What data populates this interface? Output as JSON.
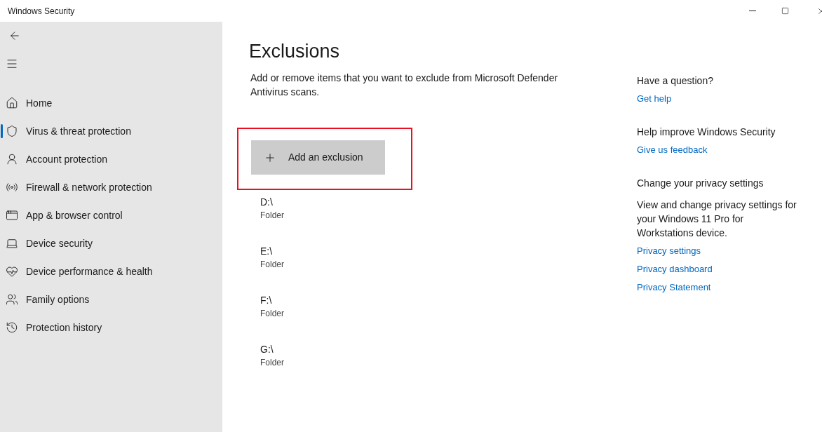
{
  "window": {
    "title": "Windows Security"
  },
  "sidebar": {
    "items": [
      {
        "kind": "home",
        "label": "Home",
        "selected": false
      },
      {
        "kind": "shield",
        "label": "Virus & threat protection",
        "selected": true
      },
      {
        "kind": "account",
        "label": "Account protection",
        "selected": false
      },
      {
        "kind": "network",
        "label": "Firewall & network protection",
        "selected": false
      },
      {
        "kind": "app",
        "label": "App & browser control",
        "selected": false
      },
      {
        "kind": "device",
        "label": "Device security",
        "selected": false
      },
      {
        "kind": "health",
        "label": "Device performance & health",
        "selected": false
      },
      {
        "kind": "family",
        "label": "Family options",
        "selected": false
      },
      {
        "kind": "history",
        "label": "Protection history",
        "selected": false
      }
    ]
  },
  "main": {
    "title": "Exclusions",
    "description": "Add or remove items that you want to exclude from Microsoft Defender Antivirus scans.",
    "add_button": "Add an exclusion",
    "highlighted": true,
    "exclusions": [
      {
        "path": "D:\\",
        "type": "Folder"
      },
      {
        "path": "E:\\",
        "type": "Folder"
      },
      {
        "path": "F:\\",
        "type": "Folder"
      },
      {
        "path": "G:\\",
        "type": "Folder"
      }
    ]
  },
  "aside": [
    {
      "heading": "Have a question?",
      "links": [
        "Get help"
      ]
    },
    {
      "heading": "Help improve Windows Security",
      "links": [
        "Give us feedback"
      ]
    },
    {
      "heading": "Change your privacy settings",
      "text": "View and change privacy settings for your Windows 11 Pro for Workstations device.",
      "links": [
        "Privacy settings",
        "Privacy dashboard",
        "Privacy Statement"
      ]
    }
  ]
}
